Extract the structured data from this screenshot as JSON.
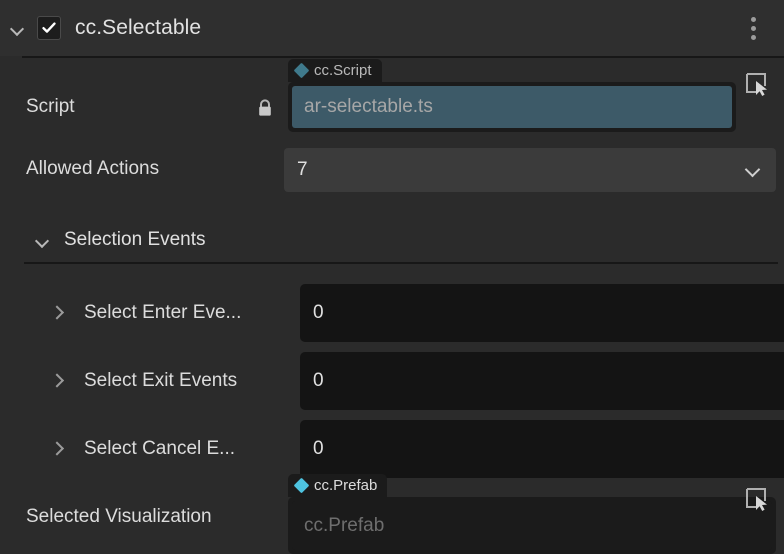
{
  "component": {
    "title": "cc.Selectable",
    "enabled_checkbox": true,
    "expand_icon": "chevron-down-icon",
    "menu_icon": "kebab-menu-icon",
    "accent_script": "#3f7a8c",
    "accent_prefab": "#4ec3e0",
    "field_blue": "#3d5a68"
  },
  "script_row": {
    "label": "Script",
    "lock_icon": "lock-icon",
    "tag_label": "cc.Script",
    "tag_icon": "diamond-icon",
    "value": "ar-selectable.ts",
    "locate_icon": "locate-node-icon"
  },
  "allowed_actions": {
    "label": "Allowed Actions",
    "value": "7",
    "caret_icon": "chevron-down-icon"
  },
  "selection_events": {
    "title": "Selection Events",
    "expand_icon": "chevron-down-icon",
    "rows": [
      {
        "label": "Select Enter Eve...",
        "value": "0",
        "caret_icon": "chevron-right-icon"
      },
      {
        "label": "Select Exit Events",
        "value": "0",
        "caret_icon": "chevron-right-icon"
      },
      {
        "label": "Select Cancel E...",
        "value": "0",
        "caret_icon": "chevron-right-icon"
      }
    ]
  },
  "selected_visualization": {
    "label": "Selected Visualization",
    "tag_label": "cc.Prefab",
    "tag_icon": "diamond-icon",
    "placeholder": "cc.Prefab",
    "locate_icon": "locate-node-icon"
  }
}
